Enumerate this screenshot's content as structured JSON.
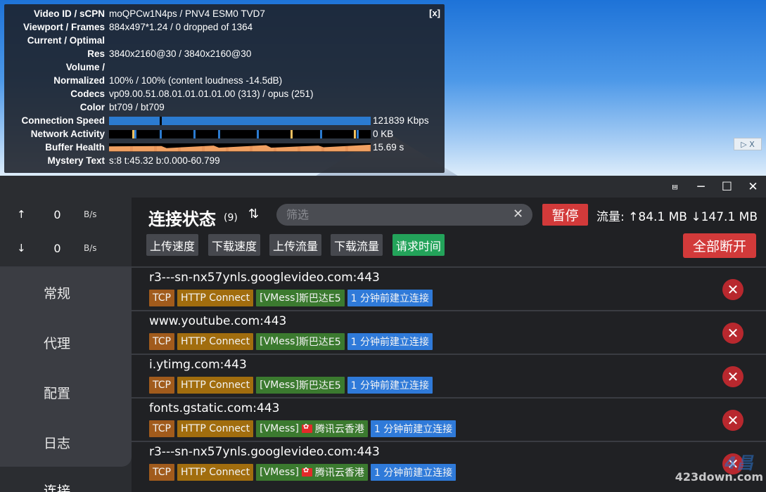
{
  "stats": {
    "close": "[x]",
    "rows": [
      {
        "key": "Video ID / sCPN",
        "value": "moQPCw1N4ps / PNV4 ESM0 TVD7"
      },
      {
        "key": "Viewport / Frames",
        "value": "884x497*1.24 / 0 dropped of 1364"
      },
      {
        "key": "Current / Optimal",
        "value": ""
      },
      {
        "key": "Res",
        "value": "3840x2160@30 / 3840x2160@30"
      },
      {
        "key": "Volume /",
        "value": ""
      },
      {
        "key": "Normalized",
        "value": "100% / 100% (content loudness -14.5dB)"
      },
      {
        "key": "Codecs",
        "value": "vp09.00.51.08.01.01.01.01.00 (313) / opus (251)"
      },
      {
        "key": "Color",
        "value": "bt709 / bt709"
      }
    ],
    "connection_speed": {
      "key": "Connection Speed",
      "value": "121839 Kbps"
    },
    "network_activity": {
      "key": "Network Activity",
      "value": "0 KB"
    },
    "buffer_health": {
      "key": "Buffer Health",
      "value": "15.69 s"
    },
    "mystery": {
      "key": "Mystery Text",
      "value": "s:8 t:45.32 b:0.000-60.799"
    }
  },
  "ad_close": "▷ X",
  "window_controls": {
    "pin": "📌",
    "minimize": "─",
    "maximize": "☐",
    "close": "✕"
  },
  "sidebar": {
    "upload": {
      "arrow": "↑",
      "value": "0",
      "unit": "B/s"
    },
    "download": {
      "arrow": "↓",
      "value": "0",
      "unit": "B/s"
    },
    "nav": [
      "常规",
      "代理",
      "配置",
      "日志",
      "连接"
    ]
  },
  "header": {
    "title": "连接状态",
    "count": "(9)",
    "sort_icon": "⇅",
    "filter_placeholder": "筛选",
    "filter_clear": "✕",
    "pause": "暂停",
    "flow": "流量: ↑84.1 MB ↓147.1 MB",
    "sort_buttons": [
      "上传速度",
      "下载速度",
      "上传流量",
      "下载流量",
      "请求时间"
    ],
    "active_sort": "请求时间",
    "disconnect_all": "全部断开"
  },
  "connections": [
    {
      "host": "r3---sn-nx57ynls.googlevideo.com:443",
      "network": "TCP",
      "type": "HTTP Connect",
      "chain_prefix": "[VMess]",
      "chain_name": "斯巴达E5",
      "flag": false,
      "time": "1 分钟前建立连接"
    },
    {
      "host": "www.youtube.com:443",
      "network": "TCP",
      "type": "HTTP Connect",
      "chain_prefix": "[VMess]",
      "chain_name": "斯巴达E5",
      "flag": false,
      "time": "1 分钟前建立连接"
    },
    {
      "host": "i.ytimg.com:443",
      "network": "TCP",
      "type": "HTTP Connect",
      "chain_prefix": "[VMess]",
      "chain_name": "斯巴达E5",
      "flag": false,
      "time": "1 分钟前建立连接"
    },
    {
      "host": "fonts.gstatic.com:443",
      "network": "TCP",
      "type": "HTTP Connect",
      "chain_prefix": "[VMess]",
      "chain_name": "腾讯云香港",
      "flag": true,
      "time": "1 分钟前建立连接"
    },
    {
      "host": "r3---sn-nx57ynls.googlevideo.com:443",
      "network": "TCP",
      "type": "HTTP Connect",
      "chain_prefix": "[VMess]",
      "chain_name": "腾讯云香港",
      "flag": true,
      "time": "1 分钟前建立连接"
    }
  ],
  "row_close": "✕",
  "watermark": {
    "logo": "4昌",
    "text": "423down.com"
  }
}
